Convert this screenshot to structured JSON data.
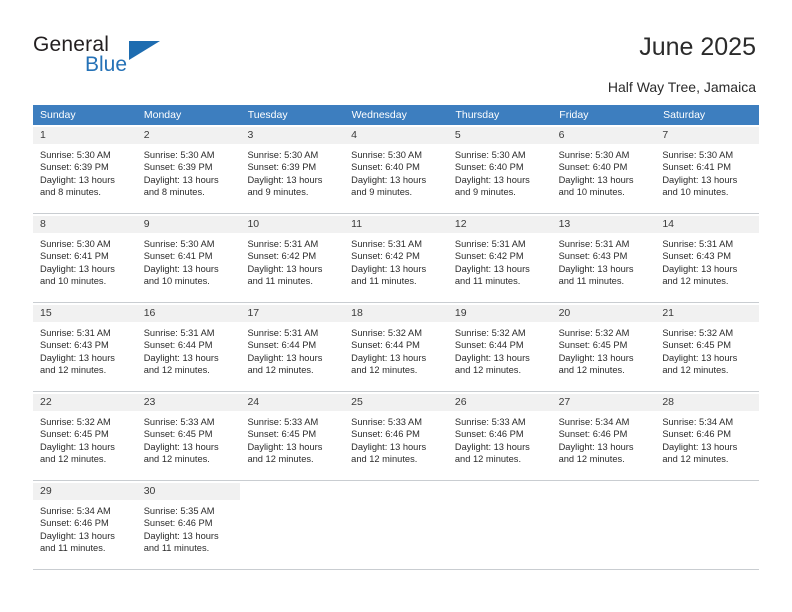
{
  "brand": {
    "name_part1": "General",
    "name_part2": "Blue",
    "accent_color": "#2572b7"
  },
  "header": {
    "title": "June 2025",
    "subtitle": "Half Way Tree, Jamaica",
    "header_bg_color": "#3d7ebf"
  },
  "weekdays": [
    "Sunday",
    "Monday",
    "Tuesday",
    "Wednesday",
    "Thursday",
    "Friday",
    "Saturday"
  ],
  "weeks": [
    [
      {
        "day": "1",
        "sunrise": "Sunrise: 5:30 AM",
        "sunset": "Sunset: 6:39 PM",
        "daylight1": "Daylight: 13 hours",
        "daylight2": "and 8 minutes."
      },
      {
        "day": "2",
        "sunrise": "Sunrise: 5:30 AM",
        "sunset": "Sunset: 6:39 PM",
        "daylight1": "Daylight: 13 hours",
        "daylight2": "and 8 minutes."
      },
      {
        "day": "3",
        "sunrise": "Sunrise: 5:30 AM",
        "sunset": "Sunset: 6:39 PM",
        "daylight1": "Daylight: 13 hours",
        "daylight2": "and 9 minutes."
      },
      {
        "day": "4",
        "sunrise": "Sunrise: 5:30 AM",
        "sunset": "Sunset: 6:40 PM",
        "daylight1": "Daylight: 13 hours",
        "daylight2": "and 9 minutes."
      },
      {
        "day": "5",
        "sunrise": "Sunrise: 5:30 AM",
        "sunset": "Sunset: 6:40 PM",
        "daylight1": "Daylight: 13 hours",
        "daylight2": "and 9 minutes."
      },
      {
        "day": "6",
        "sunrise": "Sunrise: 5:30 AM",
        "sunset": "Sunset: 6:40 PM",
        "daylight1": "Daylight: 13 hours",
        "daylight2": "and 10 minutes."
      },
      {
        "day": "7",
        "sunrise": "Sunrise: 5:30 AM",
        "sunset": "Sunset: 6:41 PM",
        "daylight1": "Daylight: 13 hours",
        "daylight2": "and 10 minutes."
      }
    ],
    [
      {
        "day": "8",
        "sunrise": "Sunrise: 5:30 AM",
        "sunset": "Sunset: 6:41 PM",
        "daylight1": "Daylight: 13 hours",
        "daylight2": "and 10 minutes."
      },
      {
        "day": "9",
        "sunrise": "Sunrise: 5:30 AM",
        "sunset": "Sunset: 6:41 PM",
        "daylight1": "Daylight: 13 hours",
        "daylight2": "and 10 minutes."
      },
      {
        "day": "10",
        "sunrise": "Sunrise: 5:31 AM",
        "sunset": "Sunset: 6:42 PM",
        "daylight1": "Daylight: 13 hours",
        "daylight2": "and 11 minutes."
      },
      {
        "day": "11",
        "sunrise": "Sunrise: 5:31 AM",
        "sunset": "Sunset: 6:42 PM",
        "daylight1": "Daylight: 13 hours",
        "daylight2": "and 11 minutes."
      },
      {
        "day": "12",
        "sunrise": "Sunrise: 5:31 AM",
        "sunset": "Sunset: 6:42 PM",
        "daylight1": "Daylight: 13 hours",
        "daylight2": "and 11 minutes."
      },
      {
        "day": "13",
        "sunrise": "Sunrise: 5:31 AM",
        "sunset": "Sunset: 6:43 PM",
        "daylight1": "Daylight: 13 hours",
        "daylight2": "and 11 minutes."
      },
      {
        "day": "14",
        "sunrise": "Sunrise: 5:31 AM",
        "sunset": "Sunset: 6:43 PM",
        "daylight1": "Daylight: 13 hours",
        "daylight2": "and 12 minutes."
      }
    ],
    [
      {
        "day": "15",
        "sunrise": "Sunrise: 5:31 AM",
        "sunset": "Sunset: 6:43 PM",
        "daylight1": "Daylight: 13 hours",
        "daylight2": "and 12 minutes."
      },
      {
        "day": "16",
        "sunrise": "Sunrise: 5:31 AM",
        "sunset": "Sunset: 6:44 PM",
        "daylight1": "Daylight: 13 hours",
        "daylight2": "and 12 minutes."
      },
      {
        "day": "17",
        "sunrise": "Sunrise: 5:31 AM",
        "sunset": "Sunset: 6:44 PM",
        "daylight1": "Daylight: 13 hours",
        "daylight2": "and 12 minutes."
      },
      {
        "day": "18",
        "sunrise": "Sunrise: 5:32 AM",
        "sunset": "Sunset: 6:44 PM",
        "daylight1": "Daylight: 13 hours",
        "daylight2": "and 12 minutes."
      },
      {
        "day": "19",
        "sunrise": "Sunrise: 5:32 AM",
        "sunset": "Sunset: 6:44 PM",
        "daylight1": "Daylight: 13 hours",
        "daylight2": "and 12 minutes."
      },
      {
        "day": "20",
        "sunrise": "Sunrise: 5:32 AM",
        "sunset": "Sunset: 6:45 PM",
        "daylight1": "Daylight: 13 hours",
        "daylight2": "and 12 minutes."
      },
      {
        "day": "21",
        "sunrise": "Sunrise: 5:32 AM",
        "sunset": "Sunset: 6:45 PM",
        "daylight1": "Daylight: 13 hours",
        "daylight2": "and 12 minutes."
      }
    ],
    [
      {
        "day": "22",
        "sunrise": "Sunrise: 5:32 AM",
        "sunset": "Sunset: 6:45 PM",
        "daylight1": "Daylight: 13 hours",
        "daylight2": "and 12 minutes."
      },
      {
        "day": "23",
        "sunrise": "Sunrise: 5:33 AM",
        "sunset": "Sunset: 6:45 PM",
        "daylight1": "Daylight: 13 hours",
        "daylight2": "and 12 minutes."
      },
      {
        "day": "24",
        "sunrise": "Sunrise: 5:33 AM",
        "sunset": "Sunset: 6:45 PM",
        "daylight1": "Daylight: 13 hours",
        "daylight2": "and 12 minutes."
      },
      {
        "day": "25",
        "sunrise": "Sunrise: 5:33 AM",
        "sunset": "Sunset: 6:46 PM",
        "daylight1": "Daylight: 13 hours",
        "daylight2": "and 12 minutes."
      },
      {
        "day": "26",
        "sunrise": "Sunrise: 5:33 AM",
        "sunset": "Sunset: 6:46 PM",
        "daylight1": "Daylight: 13 hours",
        "daylight2": "and 12 minutes."
      },
      {
        "day": "27",
        "sunrise": "Sunrise: 5:34 AM",
        "sunset": "Sunset: 6:46 PM",
        "daylight1": "Daylight: 13 hours",
        "daylight2": "and 12 minutes."
      },
      {
        "day": "28",
        "sunrise": "Sunrise: 5:34 AM",
        "sunset": "Sunset: 6:46 PM",
        "daylight1": "Daylight: 13 hours",
        "daylight2": "and 12 minutes."
      }
    ],
    [
      {
        "day": "29",
        "sunrise": "Sunrise: 5:34 AM",
        "sunset": "Sunset: 6:46 PM",
        "daylight1": "Daylight: 13 hours",
        "daylight2": "and 11 minutes."
      },
      {
        "day": "30",
        "sunrise": "Sunrise: 5:35 AM",
        "sunset": "Sunset: 6:46 PM",
        "daylight1": "Daylight: 13 hours",
        "daylight2": "and 11 minutes."
      },
      {
        "day": "",
        "sunrise": "",
        "sunset": "",
        "daylight1": "",
        "daylight2": ""
      },
      {
        "day": "",
        "sunrise": "",
        "sunset": "",
        "daylight1": "",
        "daylight2": ""
      },
      {
        "day": "",
        "sunrise": "",
        "sunset": "",
        "daylight1": "",
        "daylight2": ""
      },
      {
        "day": "",
        "sunrise": "",
        "sunset": "",
        "daylight1": "",
        "daylight2": ""
      },
      {
        "day": "",
        "sunrise": "",
        "sunset": "",
        "daylight1": "",
        "daylight2": ""
      }
    ]
  ]
}
